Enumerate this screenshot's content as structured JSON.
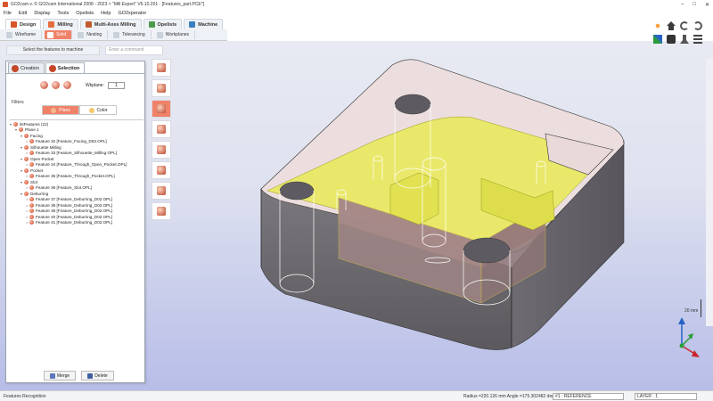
{
  "window": {
    "title": "GO2cam v. © GO2cam International 2008 - 2023 ˅  \"Mill Expert\"  V6.10.201 - [Features_part.PCE*]",
    "controls": [
      "–",
      "□",
      "✕"
    ]
  },
  "menu": [
    "File",
    "Edit",
    "Display",
    "Tools",
    "Opelists",
    "Help",
    "GO2xperator"
  ],
  "ribbon": {
    "tabs": [
      {
        "label": "Design",
        "active": true
      },
      {
        "label": "Milling",
        "active": false
      },
      {
        "label": "Multi-Axes Milling",
        "active": false
      },
      {
        "label": "Opelists",
        "active": false
      },
      {
        "label": "Machine",
        "active": false
      }
    ],
    "subtabs": [
      {
        "label": "Wireframe",
        "active": false
      },
      {
        "label": "Solid",
        "active": true
      },
      {
        "label": "Nesting",
        "active": false
      },
      {
        "label": "Tolerancing",
        "active": false
      },
      {
        "label": "Workplanes",
        "active": false
      }
    ]
  },
  "command": {
    "prompt": "Select the features to machine",
    "placeholder": "Enter a command"
  },
  "panel": {
    "tabs": [
      {
        "label": "Creation",
        "active": false
      },
      {
        "label": "Selection",
        "active": true
      }
    ],
    "wkplane_label": "Wkplane:",
    "wkplane_value": "1",
    "filters_label": "Filters",
    "filters": [
      {
        "label": "Plans",
        "active": true
      },
      {
        "label": "Color",
        "active": false
      }
    ],
    "tree": [
      {
        "level": 0,
        "toggle": "▾",
        "text": "lstFeatures (22)"
      },
      {
        "level": 1,
        "toggle": "▾",
        "text": "Plane 1"
      },
      {
        "level": 2,
        "toggle": "▾",
        "text": "Facing"
      },
      {
        "level": 3,
        "toggle": ">",
        "text": "Feature 32 [Feature_Facing_D63.OPL]"
      },
      {
        "level": 2,
        "toggle": "▾",
        "text": "Silhouette Milling"
      },
      {
        "level": 3,
        "toggle": ">",
        "text": "Feature 33 [Feature_Silhouette_Milling.OPL]"
      },
      {
        "level": 2,
        "toggle": "▾",
        "text": "Open Pocket"
      },
      {
        "level": 3,
        "toggle": ">",
        "text": "Feature 34 [Feature_Through_Open_Pocket.OPL]"
      },
      {
        "level": 2,
        "toggle": "▾",
        "text": "Pocket"
      },
      {
        "level": 3,
        "toggle": ">",
        "text": "Feature 35 [Feature_Through_Pocket.OPL]"
      },
      {
        "level": 2,
        "toggle": "▾",
        "text": "Slot"
      },
      {
        "level": 3,
        "toggle": ">",
        "text": "Feature 36 [Feature_Slot.OPL]"
      },
      {
        "level": 2,
        "toggle": "▾",
        "text": "Deburring"
      },
      {
        "level": 3,
        "toggle": ">",
        "text": "Feature 37 [Feature_Deburring_D02.OPL]"
      },
      {
        "level": 3,
        "toggle": ">",
        "text": "Feature 38 [Feature_Deburring_D02.OPL]"
      },
      {
        "level": 3,
        "toggle": ">",
        "text": "Feature 39 [Feature_Deburring_D02.OPL]"
      },
      {
        "level": 3,
        "toggle": ">",
        "text": "Feature 40 [Feature_Deburring_D02.OPL]"
      },
      {
        "level": 3,
        "toggle": ">",
        "text": "Feature 41 [Feature_Deburring_D02.OPL]"
      }
    ],
    "merge_label": "Merge",
    "delete_label": "Delete"
  },
  "viewport": {
    "scale_label": "20 mm"
  },
  "status": {
    "left": "Features Recognition",
    "coords": "Radius =220.126 mm  Angle =175.302482 deg",
    "reference": "#1 : REFERENCE",
    "layer": "LAYER : 1"
  },
  "colors": {
    "accent": "#f0826a",
    "part_top": "#ecdcdc",
    "part_side": "#66646a",
    "selection": "#e6e65a",
    "viewport_bottom": "#b7bde8"
  }
}
